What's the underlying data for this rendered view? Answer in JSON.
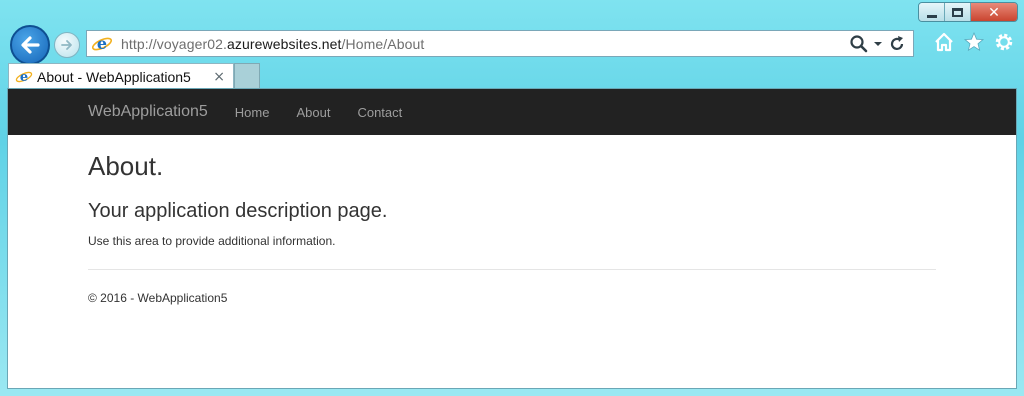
{
  "browser": {
    "url_prefix": "http://voyager02.",
    "url_host": "azurewebsites.net",
    "url_path": "/Home/About",
    "tab_title": "About - WebApplication5",
    "tab_close": "×",
    "close_glyph": "✕",
    "icons": [
      "back-arrow-icon",
      "forward-arrow-icon",
      "ie-icon",
      "search-icon",
      "dropdown-icon",
      "refresh-icon",
      "home-icon",
      "favorites-star-icon",
      "settings-gear-icon"
    ]
  },
  "site": {
    "brand": "WebApplication5",
    "nav": [
      "Home",
      "About",
      "Contact"
    ],
    "title": "About.",
    "subtitle": "Your application description page.",
    "body": "Use this area to provide additional information.",
    "footer": "© 2016 - WebApplication5"
  }
}
